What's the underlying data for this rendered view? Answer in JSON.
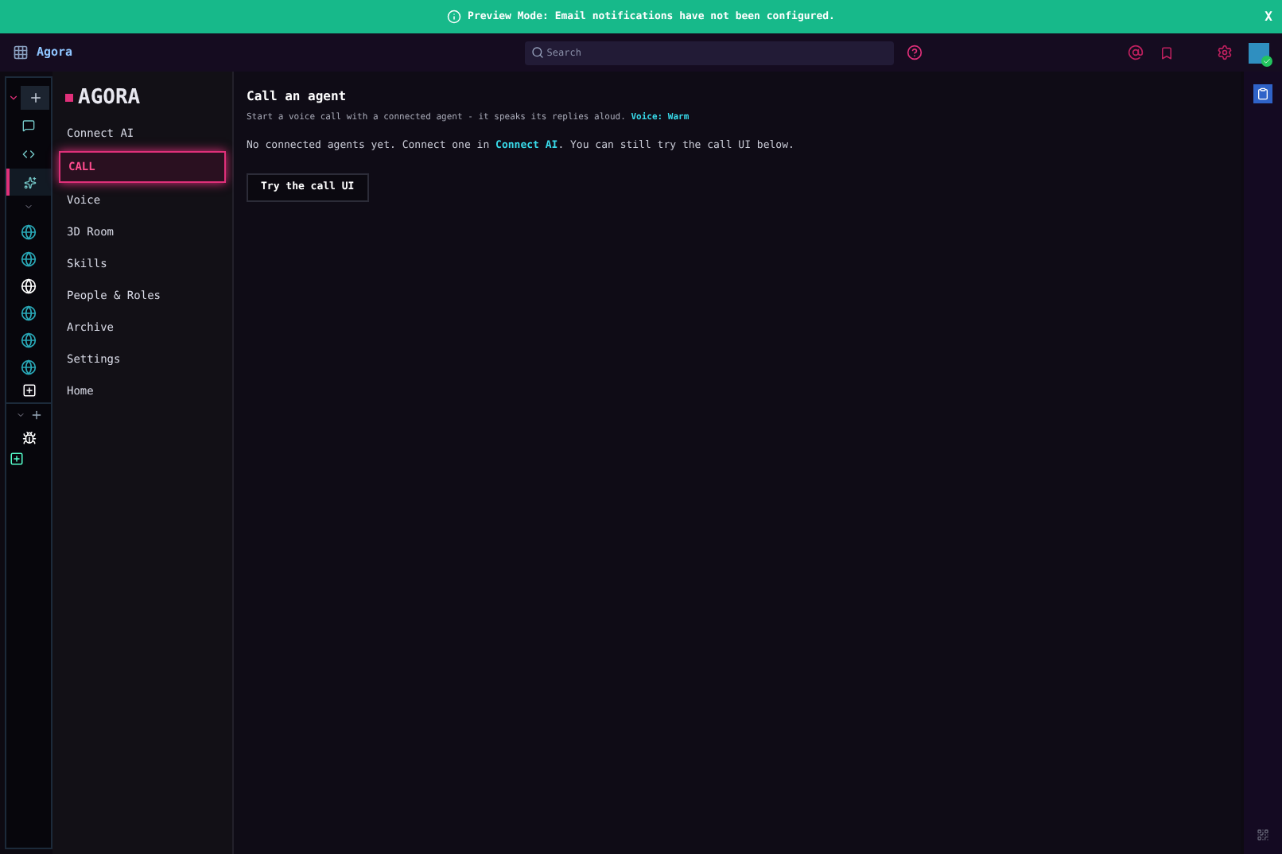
{
  "banner": {
    "text": "Preview Mode: Email notifications have not been configured.",
    "close": "X"
  },
  "topbar": {
    "app_name": "Agora",
    "search": {
      "placeholder": "Search"
    }
  },
  "rail": {
    "items": [
      {
        "kind": "chat",
        "selected": false
      },
      {
        "kind": "code",
        "selected": false
      },
      {
        "kind": "sparkle",
        "selected": true
      }
    ],
    "servers": [
      {
        "kind": "globe",
        "selected": false
      },
      {
        "kind": "globe",
        "selected": false
      },
      {
        "kind": "globe",
        "selected": true
      },
      {
        "kind": "globe",
        "selected": false
      },
      {
        "kind": "globe",
        "selected": false
      },
      {
        "kind": "globe",
        "selected": false
      }
    ]
  },
  "nav": {
    "logo": "AGORA",
    "items": [
      {
        "label": "Connect AI",
        "selected": false
      },
      {
        "label": "CALL",
        "selected": true
      },
      {
        "label": "Voice",
        "selected": false
      },
      {
        "label": "3D Room",
        "selected": false
      },
      {
        "label": "Skills",
        "selected": false
      },
      {
        "label": "People & Roles",
        "selected": false
      },
      {
        "label": "Archive",
        "selected": false
      },
      {
        "label": "Settings",
        "selected": false
      },
      {
        "label": "Home",
        "selected": false
      }
    ]
  },
  "main": {
    "title": "Call an agent",
    "description": "Start a voice call with a connected agent - it speaks its replies aloud.",
    "voice_link": "Voice: Warm",
    "message_before": "No connected agents yet. Connect one in",
    "message_link": "Connect AI",
    "message_after": ". You can still try the call UI below.",
    "button": "Try the call UI"
  }
}
